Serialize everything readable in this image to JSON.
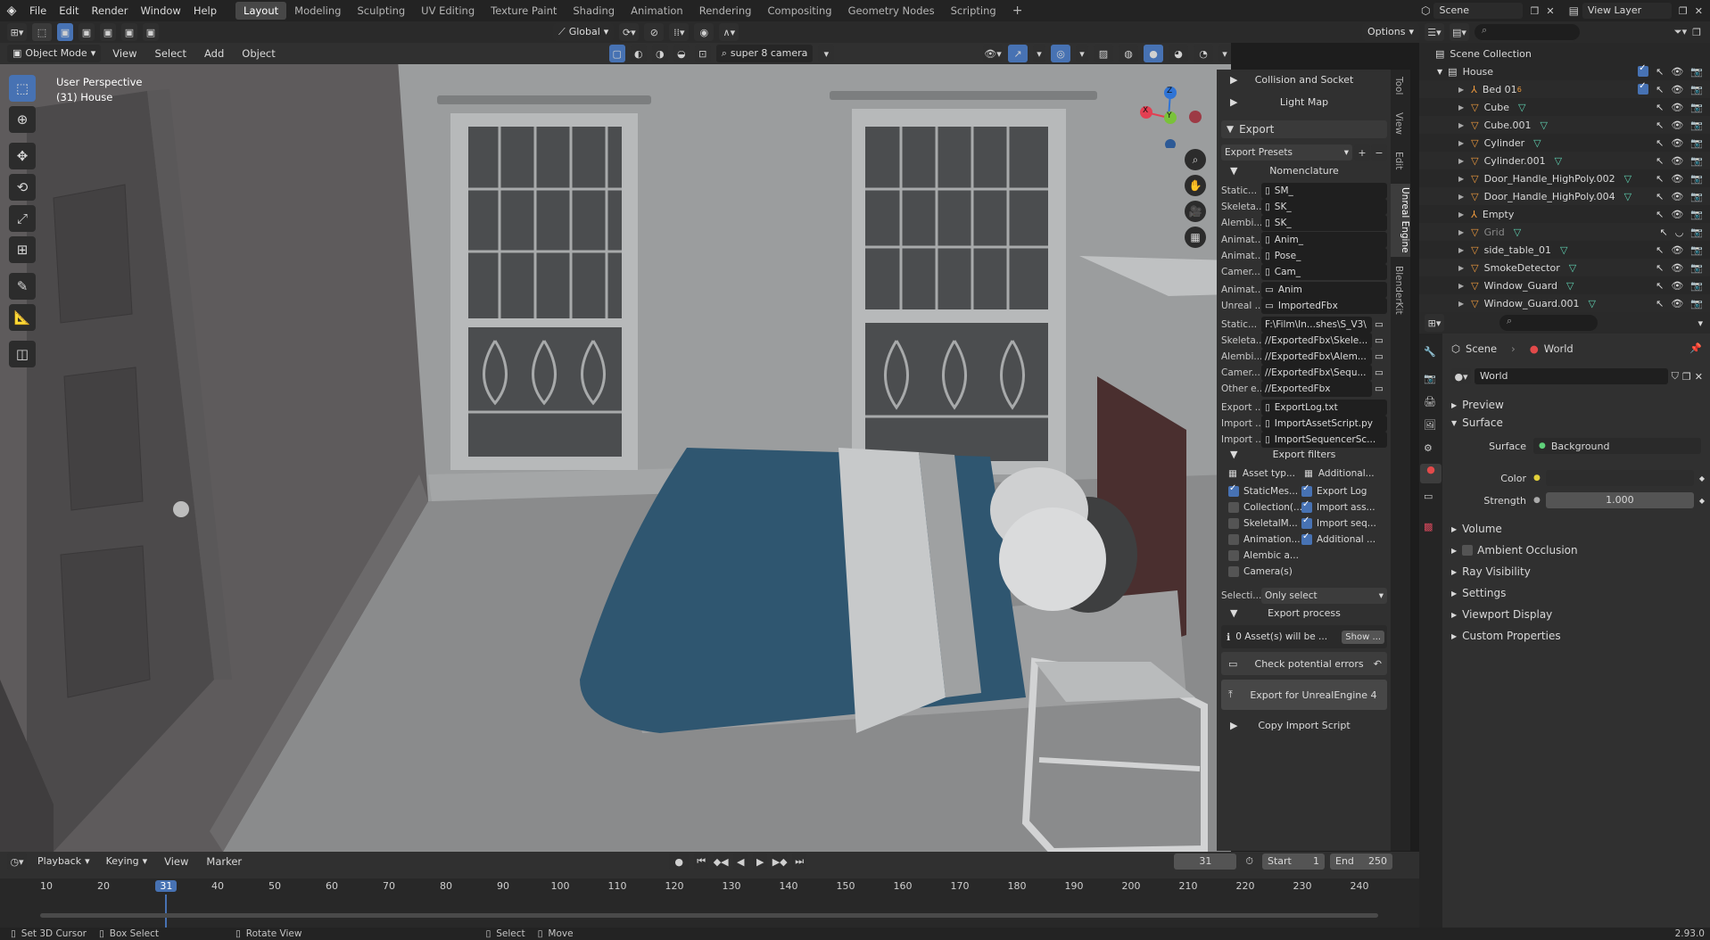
{
  "topbar": {
    "menus": [
      "File",
      "Edit",
      "Render",
      "Window",
      "Help"
    ],
    "workspaces": [
      "Layout",
      "Modeling",
      "Sculpting",
      "UV Editing",
      "Texture Paint",
      "Shading",
      "Animation",
      "Rendering",
      "Compositing",
      "Geometry Nodes",
      "Scripting"
    ],
    "active_workspace": "Layout",
    "scene": "Scene",
    "view_layer": "View Layer"
  },
  "viewport_header": {
    "mode": "Object Mode",
    "menus": [
      "View",
      "Select",
      "Add",
      "Object"
    ],
    "transform_orientation": "Global",
    "camera": "super 8 camera",
    "options": "Options"
  },
  "viewport": {
    "perspective_label": "User Perspective",
    "collection_label": "(31) House",
    "gizmo_axes": {
      "z": "Z",
      "x": "X",
      "y": "Y"
    }
  },
  "npanel": {
    "tabs": [
      "Tool",
      "View",
      "Edit",
      "Unreal Engine",
      "BlenderKit"
    ],
    "collapsed_top": [
      "Collision and Socket",
      "Light Map"
    ],
    "export_header": "Export",
    "export_presets": "Export Presets",
    "nomenclature_header": "Nomenclature",
    "nomenclature": [
      {
        "label": "Static...",
        "value": "SM_",
        "icon": "file"
      },
      {
        "label": "Skeleta...",
        "value": "SK_",
        "icon": "file"
      },
      {
        "label": "Alembi...",
        "value": "SK_",
        "icon": "file"
      },
      {
        "label": "Animat...",
        "value": "Anim_",
        "icon": "file"
      },
      {
        "label": "Animat...",
        "value": "Pose_",
        "icon": "file"
      },
      {
        "label": "Camer...",
        "value": "Cam_",
        "icon": "file"
      },
      {
        "label": "Animat...",
        "value": "Anim",
        "icon": "folder"
      },
      {
        "label": "Unreal ...",
        "value": "ImportedFbx",
        "icon": "folder"
      },
      {
        "label": "Static...",
        "value": "F:\\Film\\In...shes\\S_V3\\",
        "icon": "browse"
      },
      {
        "label": "Skeleta...",
        "value": "//ExportedFbx\\Skele...",
        "icon": "browse"
      },
      {
        "label": "Alembi...",
        "value": "//ExportedFbx\\Alem...",
        "icon": "browse"
      },
      {
        "label": "Camer...",
        "value": "//ExportedFbx\\Sequ...",
        "icon": "browse"
      },
      {
        "label": "Other e...",
        "value": "//ExportedFbx",
        "icon": "browse"
      },
      {
        "label": "Export ...",
        "value": "ExportLog.txt",
        "icon": "file"
      },
      {
        "label": "Import ...",
        "value": "ImportAssetScript.py",
        "icon": "file"
      },
      {
        "label": "Import ...",
        "value": "ImportSequencerSc...",
        "icon": "file"
      }
    ],
    "filters_header": "Export filters",
    "filter_left_head": "Asset typ...",
    "filter_right_head": "Additional...",
    "filters_left": [
      {
        "label": "StaticMes...",
        "checked": true
      },
      {
        "label": "Collection(...",
        "checked": false
      },
      {
        "label": "SkeletalM...",
        "checked": false
      },
      {
        "label": "Animation...",
        "checked": false
      },
      {
        "label": "Alembic a...",
        "checked": false
      },
      {
        "label": "Camera(s)",
        "checked": false
      }
    ],
    "filters_right": [
      {
        "label": "Export Log",
        "checked": true
      },
      {
        "label": "Import ass...",
        "checked": true
      },
      {
        "label": "Import seq...",
        "checked": true
      },
      {
        "label": "Additional ...",
        "checked": true
      }
    ],
    "selection_label": "Selecti...",
    "selection_value": "Only select",
    "process_header": "Export process",
    "asset_count": "0 Asset(s) will be ...",
    "show": "Show ...",
    "check_errors": "Check potential errors",
    "export_button": "Export for UnrealEngine 4",
    "copy_script": "Copy Import Script"
  },
  "outliner": {
    "root": "Scene Collection",
    "collection": "House",
    "items": [
      {
        "name": "Bed 01",
        "icon": "empty",
        "extra": "6"
      },
      {
        "name": "Cube",
        "icon": "mesh"
      },
      {
        "name": "Cube.001",
        "icon": "mesh"
      },
      {
        "name": "Cylinder",
        "icon": "mesh"
      },
      {
        "name": "Cylinder.001",
        "icon": "mesh"
      },
      {
        "name": "Door_Handle_HighPoly.002",
        "icon": "mesh"
      },
      {
        "name": "Door_Handle_HighPoly.004",
        "icon": "mesh"
      },
      {
        "name": "Empty",
        "icon": "empty"
      },
      {
        "name": "Grid",
        "icon": "mesh",
        "dim": true
      },
      {
        "name": "side_table_01",
        "icon": "mesh"
      },
      {
        "name": "SmokeDetector",
        "icon": "mesh"
      },
      {
        "name": "Window_Guard",
        "icon": "mesh"
      },
      {
        "name": "Window_Guard.001",
        "icon": "mesh"
      }
    ]
  },
  "properties": {
    "breadcrumb_scene": "Scene",
    "breadcrumb_world": "World",
    "world_name": "World",
    "sections": [
      "Preview",
      "Surface"
    ],
    "surface_label": "Surface",
    "surface_value": "Background",
    "color_label": "Color",
    "strength_label": "Strength",
    "strength_value": "1.000",
    "collapsed": [
      "Volume",
      "Ambient Occlusion",
      "Ray Visibility",
      "Settings",
      "Viewport Display",
      "Custom Properties"
    ]
  },
  "timeline": {
    "menus": [
      "Playback",
      "Keying",
      "View",
      "Marker"
    ],
    "current_frame": "31",
    "start_label": "Start",
    "start": "1",
    "end_label": "End",
    "end": "250",
    "ticks": [
      "10",
      "20",
      "31",
      "40",
      "50",
      "60",
      "70",
      "80",
      "90",
      "100",
      "110",
      "120",
      "130",
      "140",
      "150",
      "160",
      "170",
      "180",
      "190",
      "200",
      "210",
      "220",
      "230",
      "240"
    ]
  },
  "statusbar": {
    "hints": [
      "Set 3D Cursor",
      "Box Select",
      "Rotate View",
      "Select",
      "Move"
    ],
    "version": "2.93.0"
  },
  "colors": {
    "accent": "#4772b3",
    "mesh_icon": "#5fd1b1",
    "object_icon": "#ee9a3e",
    "blanket": "#2f5670"
  }
}
